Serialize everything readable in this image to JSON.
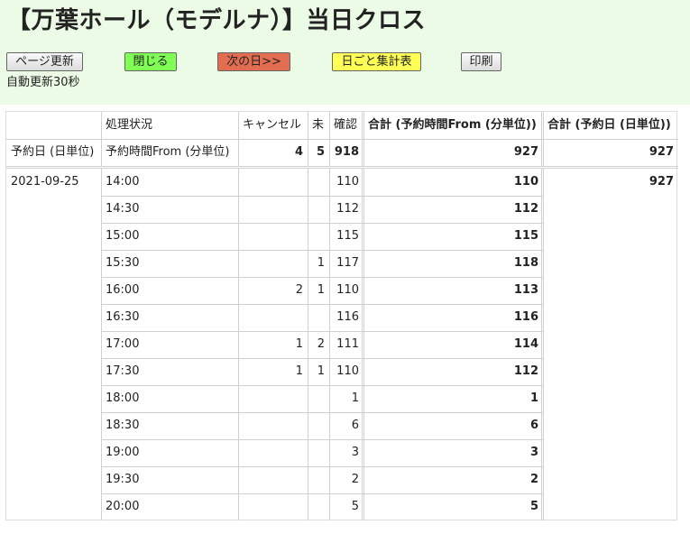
{
  "header": {
    "title": "【万葉ホール（モデルナ）】当日クロス",
    "buttons": {
      "reload": "ページ更新",
      "close": "閉じる",
      "next_day": "次の日>>",
      "daily_summary": "日ごと集計表",
      "print": "印刷"
    },
    "auto_refresh": "自動更新30秒"
  },
  "table": {
    "col_headers": {
      "status": "処理状況",
      "cancel": "キャンセル",
      "pending": "未",
      "confirmed": "確認",
      "total_by_time": "合計 (予約時間From (分単位))",
      "total_by_date": "合計 (予約日 (日単位))"
    },
    "row_headers": {
      "date_label": "予約日 (日単位)",
      "time_label": "予約時間From (分単位)"
    },
    "totals": {
      "cancel": "4",
      "pending": "5",
      "confirmed": "918",
      "total_by_time": "927",
      "total_by_date": "927"
    },
    "date": "2021-09-25",
    "date_total": "927",
    "rows": [
      {
        "time": "14:00",
        "cancel": "",
        "pending": "",
        "confirmed": "110",
        "total": "110"
      },
      {
        "time": "14:30",
        "cancel": "",
        "pending": "",
        "confirmed": "112",
        "total": "112"
      },
      {
        "time": "15:00",
        "cancel": "",
        "pending": "",
        "confirmed": "115",
        "total": "115"
      },
      {
        "time": "15:30",
        "cancel": "",
        "pending": "1",
        "confirmed": "117",
        "total": "118"
      },
      {
        "time": "16:00",
        "cancel": "2",
        "pending": "1",
        "confirmed": "110",
        "total": "113"
      },
      {
        "time": "16:30",
        "cancel": "",
        "pending": "",
        "confirmed": "116",
        "total": "116"
      },
      {
        "time": "17:00",
        "cancel": "1",
        "pending": "2",
        "confirmed": "111",
        "total": "114"
      },
      {
        "time": "17:30",
        "cancel": "1",
        "pending": "1",
        "confirmed": "110",
        "total": "112"
      },
      {
        "time": "18:00",
        "cancel": "",
        "pending": "",
        "confirmed": "1",
        "total": "1"
      },
      {
        "time": "18:30",
        "cancel": "",
        "pending": "",
        "confirmed": "6",
        "total": "6"
      },
      {
        "time": "19:00",
        "cancel": "",
        "pending": "",
        "confirmed": "3",
        "total": "3"
      },
      {
        "time": "19:30",
        "cancel": "",
        "pending": "",
        "confirmed": "2",
        "total": "2"
      },
      {
        "time": "20:00",
        "cancel": "",
        "pending": "",
        "confirmed": "5",
        "total": "5"
      }
    ]
  },
  "colors": {
    "header_bg": "#ebfbe6",
    "close_button": "#80ff55",
    "next_button": "#e26d50",
    "summary_button": "#ffff55"
  }
}
